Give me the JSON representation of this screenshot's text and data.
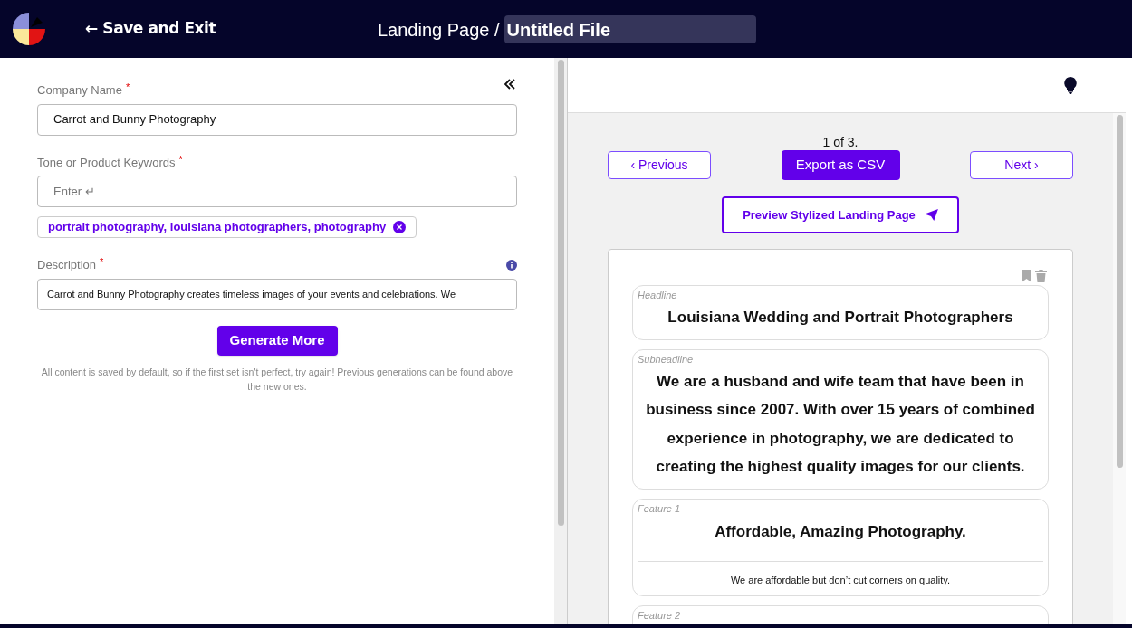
{
  "header": {
    "back_link": "← Save and Exit",
    "breadcrumb": "Landing Page /",
    "file_name": "Untitled File"
  },
  "form": {
    "fields": [
      {
        "label": "Company Name",
        "required_mark": "*",
        "value": "Carrot and Bunny Photography",
        "info": false
      },
      {
        "label": "Tone or Product Keywords",
        "required_mark": "*",
        "placeholder": "Enter ↵",
        "tags": [
          "portrait photography, louisiana photographers, photography"
        ],
        "info": false
      },
      {
        "label": "Description",
        "required_mark": "*",
        "value": "Carrot and Bunny Photography creates timeless images of your events and celebrations. We",
        "info": true
      }
    ],
    "generate_button": "Generate More",
    "note": "All content is saved by default, so if the first set isn't perfect, try again! Previous generations can be found above the new ones."
  },
  "results": {
    "counter": "1 of 3.",
    "previous_button": "‹ Previous",
    "export_button": "Export as CSV",
    "next_button": "Next ›",
    "preview_button": "Preview Stylized Landing Page",
    "sections": [
      {
        "kind": "single",
        "label": "Headline",
        "text": "Louisiana Wedding and Portrait Photographers"
      },
      {
        "kind": "single",
        "label": "Subheadline",
        "text": "We are a husband and wife team that have been in business since 2007. With over 15 years of combined experience in photography, we are dedicated to creating the highest quality images for our clients."
      },
      {
        "kind": "feature",
        "label": "Feature 1",
        "title": "Affordable, Amazing Photography.",
        "body": "We are affordable but don’t cut corners on quality."
      },
      {
        "kind": "feature",
        "label": "Feature 2"
      }
    ]
  }
}
